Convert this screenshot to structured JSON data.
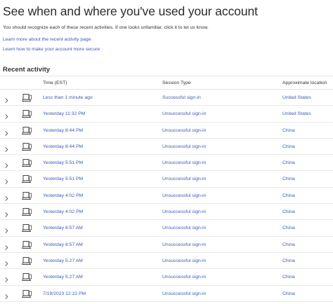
{
  "page": {
    "title": "See when and where you've used your account",
    "subtitle": "You should recognize each of these recent activities. If one looks unfamiliar, click it to let us know.",
    "links": [
      "Learn more about the recent activity page",
      "Learn how to make your account more secure"
    ],
    "section_title": "Recent activity"
  },
  "colors": {
    "link": "#3b59b8",
    "text": "#2b2b2b",
    "divider": "#e3e3e3"
  },
  "table": {
    "headers": {
      "time": "Time (EST)",
      "session": "Session Type",
      "location": "Approximate location"
    },
    "row_icons": {
      "expand": "chevron-right-icon",
      "device": "laptop-icon"
    },
    "rows": [
      {
        "time": "Less than 1 minute ago",
        "session": "Successful sign-in",
        "location": "United States"
      },
      {
        "time": "Yesterday 11:32 PM",
        "session": "Unsuccessful sign-in",
        "location": "United States"
      },
      {
        "time": "Yesterday 8:44 PM",
        "session": "Unsuccessful sign-in",
        "location": "China"
      },
      {
        "time": "Yesterday 8:44 PM",
        "session": "Unsuccessful sign-in",
        "location": "China"
      },
      {
        "time": "Yesterday 5:51 PM",
        "session": "Unsuccessful sign-in",
        "location": "China"
      },
      {
        "time": "Yesterday 5:51 PM",
        "session": "Unsuccessful sign-in",
        "location": "China"
      },
      {
        "time": "Yesterday 4:02 PM",
        "session": "Unsuccessful sign-in",
        "location": "China"
      },
      {
        "time": "Yesterday 4:02 PM",
        "session": "Unsuccessful sign-in",
        "location": "China"
      },
      {
        "time": "Yesterday 8:57 AM",
        "session": "Unsuccessful sign-in",
        "location": "China"
      },
      {
        "time": "Yesterday 8:57 AM",
        "session": "Unsuccessful sign-in",
        "location": "China"
      },
      {
        "time": "Yesterday 5:27 AM",
        "session": "Unsuccessful sign-in",
        "location": "China"
      },
      {
        "time": "Yesterday 5:27 AM",
        "session": "Unsuccessful sign-in",
        "location": "China"
      },
      {
        "time": "7/19/2023 12:22 PM",
        "session": "Unsuccessful sign-in",
        "location": "China"
      }
    ]
  }
}
